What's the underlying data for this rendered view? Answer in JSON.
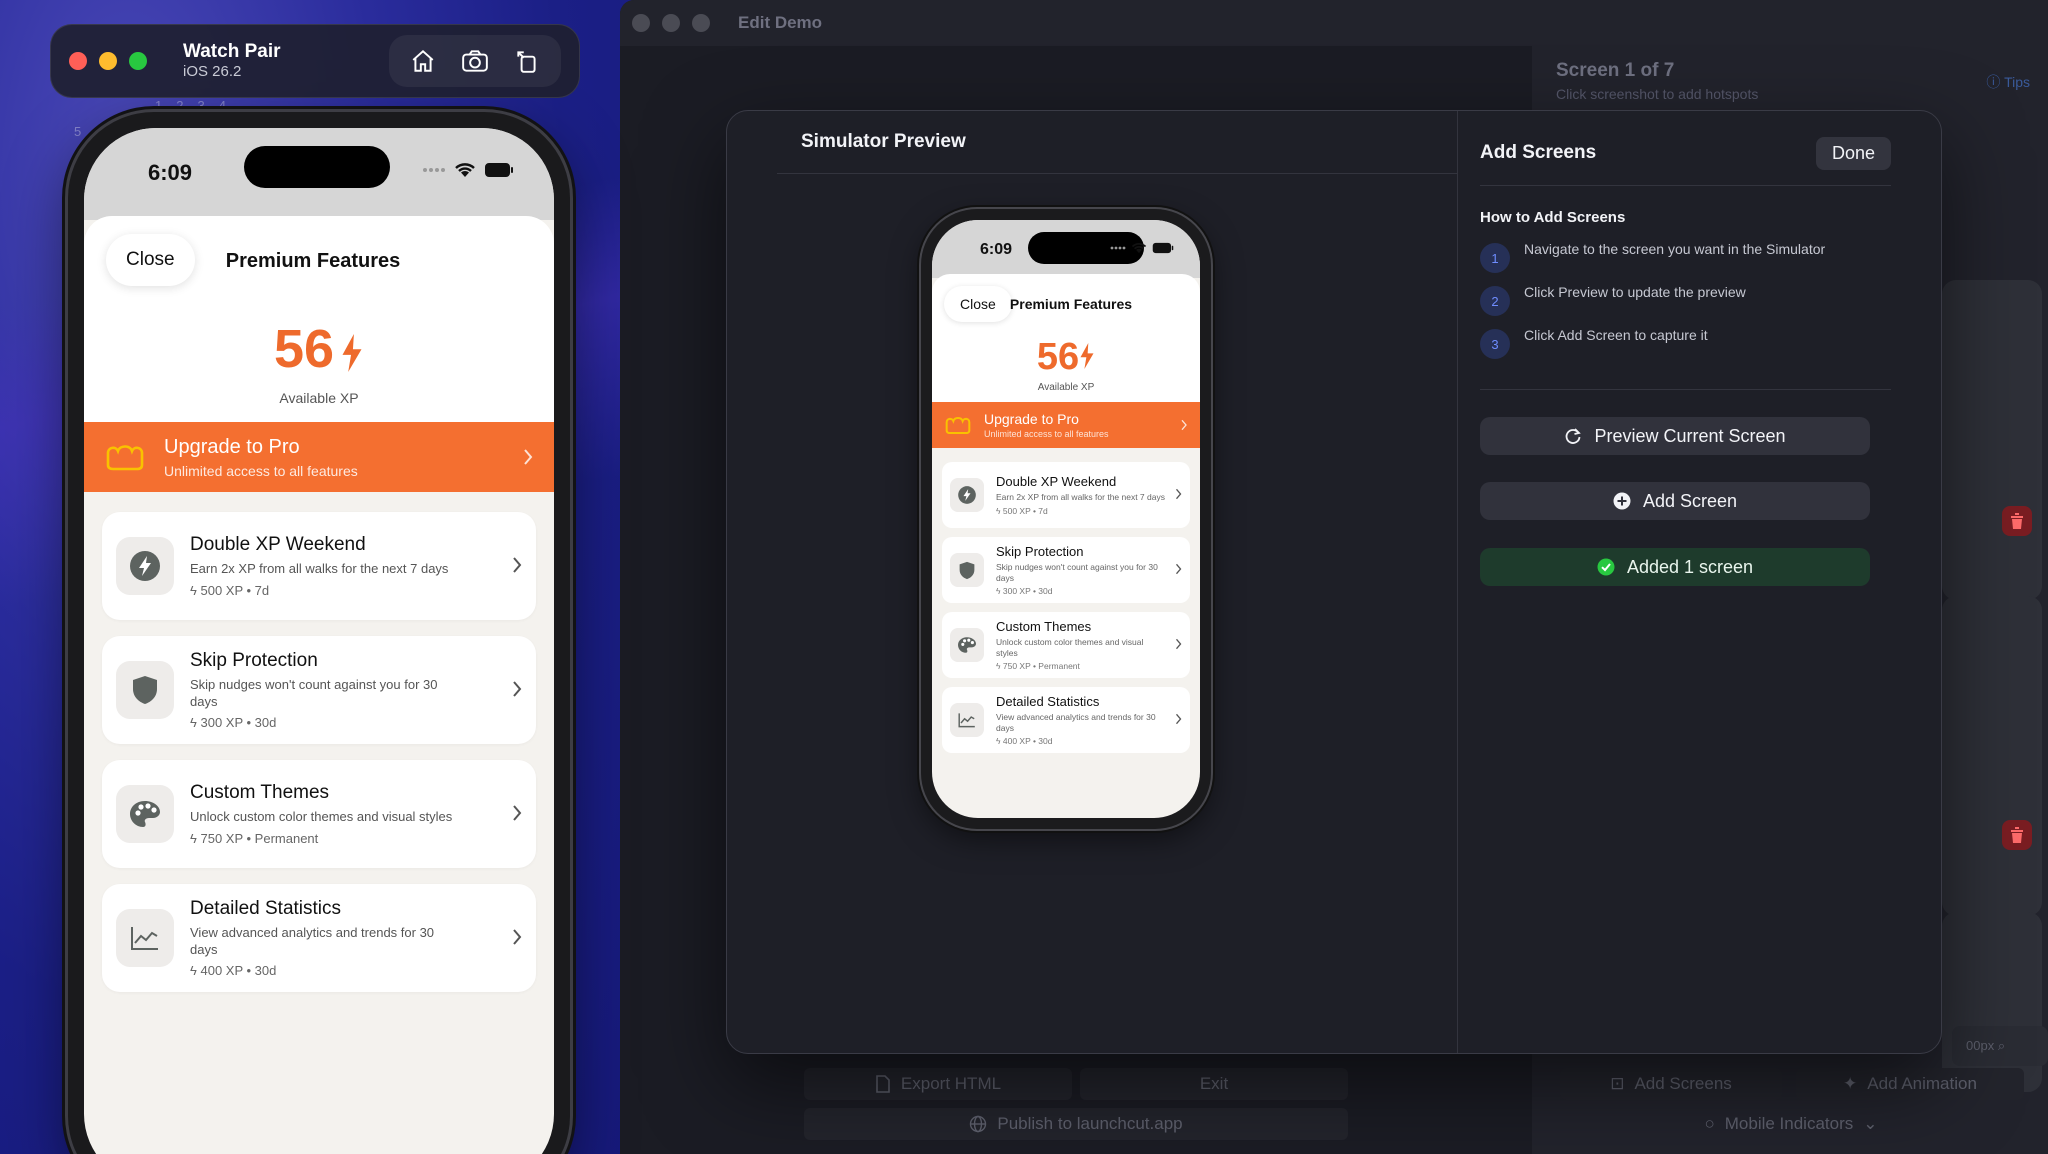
{
  "simulator": {
    "device_name": "Watch Pair",
    "os_version": "iOS 26.2",
    "ghost_numbers": "1234",
    "ghost_side": [
      "5",
      "1"
    ]
  },
  "phone": {
    "time": "6:09",
    "close_label": "Close",
    "title": "Premium Features",
    "xp_value": "56",
    "xp_label": "Available XP",
    "upgrade": {
      "title": "Upgrade to Pro",
      "subtitle": "Unlimited access to all features"
    },
    "features": [
      {
        "title": "Double XP Weekend",
        "description": "Earn 2x XP from all walks for the next 7 days",
        "meta": "500 XP • 7d",
        "icon": "bolt-icon"
      },
      {
        "title": "Skip Protection",
        "description": "Skip nudges won't count against you for 30 days",
        "meta": "300 XP • 30d",
        "icon": "shield-icon"
      },
      {
        "title": "Custom Themes",
        "description": "Unlock custom color themes and visual styles",
        "meta": "750 XP • Permanent",
        "icon": "palette-icon"
      },
      {
        "title": "Detailed Statistics",
        "description": "View advanced analytics and trends for 30 days",
        "meta": "400 XP • 30d",
        "icon": "chart-icon"
      }
    ]
  },
  "edit_window": {
    "title": "Edit Demo",
    "screen_label": "Screen 1 of 7",
    "screen_hint": "Click screenshot to add hotspots",
    "tips_label": "Tips",
    "zoom_label": "00px",
    "bottom": {
      "export_html": "Export HTML",
      "exit": "Exit",
      "publish": "Publish to launchcut.app",
      "add_screens": "Add Screens",
      "add_animation": "Add Animation",
      "mobile_indicators": "Mobile Indicators"
    }
  },
  "modal": {
    "left_title": "Simulator Preview",
    "right_title": "Add Screens",
    "done_label": "Done",
    "howto_title": "How to Add Screens",
    "steps": [
      {
        "num": "1",
        "text": "Navigate to the screen you want in the Simulator"
      },
      {
        "num": "2",
        "text": "Click Preview to update the preview"
      },
      {
        "num": "3",
        "text": "Click Add Screen to capture it"
      }
    ],
    "preview_button": "Preview Current Screen",
    "add_screen_button": "Add Screen",
    "status_message": "Added 1 screen"
  },
  "colors": {
    "accent_orange": "#f46f30",
    "xp_orange": "#ee6a2c",
    "success_green": "#28c840",
    "step_blue": "#6f8dff"
  }
}
